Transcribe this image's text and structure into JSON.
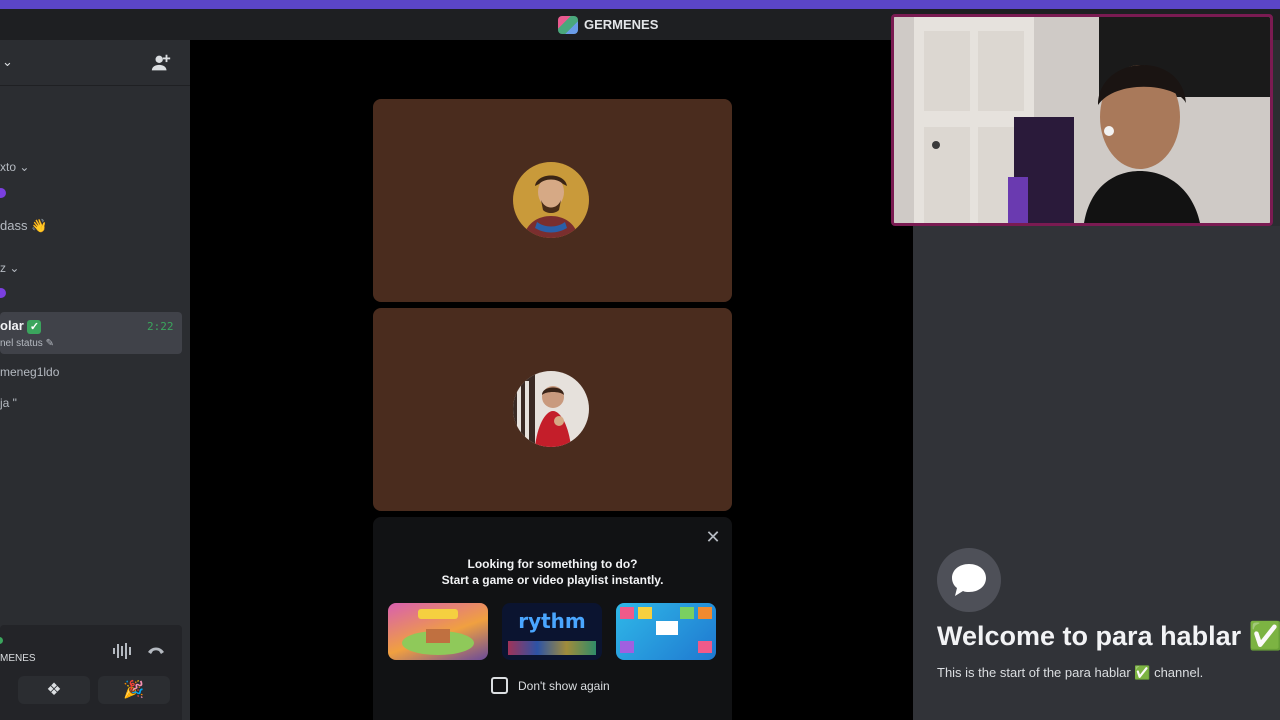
{
  "window": {
    "title": "GERMENES",
    "accent_color": "#5b45c7"
  },
  "sidebar": {
    "items": [
      {
        "label": "xto ⌄"
      },
      {
        "label": "dass"
      },
      {
        "label": "z ⌄"
      },
      {
        "label": "olar",
        "status": "nel status",
        "timer": "2:22"
      },
      {
        "label": "meneg1ldo"
      },
      {
        "label": "ja \""
      }
    ],
    "user_panel": {
      "name": "MENES"
    }
  },
  "stage": {
    "tiles": [
      {
        "avatar": "painted-portrait-avatar",
        "bg_color": "#4a2c1e"
      },
      {
        "avatar": "child-photo-avatar",
        "bg_color": "#4a2c1e"
      }
    ],
    "activity_prompt": {
      "line1": "Looking for something to do?",
      "line2": "Start a game or video playlist instantly.",
      "games": [
        {
          "name": "game-thumbnail-1"
        },
        {
          "name": "rythm",
          "label": "rythm"
        },
        {
          "name": "game-thumbnail-3"
        }
      ],
      "dont_show_label": "Don't show again"
    }
  },
  "channel": {
    "welcome_title": "Welcome to para hablar ✅",
    "start_text": "This is the start of the para hablar ✅ channel."
  }
}
